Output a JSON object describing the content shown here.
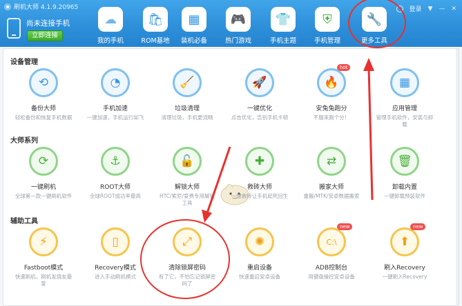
{
  "window": {
    "title": "刷机大师 4.1.9.20965",
    "login": "登录"
  },
  "device": {
    "status": "尚未连接手机",
    "connect_label": "立即连接"
  },
  "nav": [
    {
      "label": "我的手机",
      "icon": "cloud-icon",
      "color": "#6bb9ee"
    },
    {
      "label": "ROM基地",
      "icon": "shopping-bag-icon",
      "color": "#ffffff"
    },
    {
      "label": "装机必备",
      "icon": "grid-icon",
      "color": "#ffffff"
    },
    {
      "label": "热门游戏",
      "icon": "gamepad-icon",
      "color": "#f7a828"
    },
    {
      "label": "手机主题",
      "icon": "shirt-icon",
      "color": "#ffffff"
    },
    {
      "label": "手机管理",
      "icon": "shield-phone-icon",
      "color": "#4aae3c"
    },
    {
      "label": "更多工具",
      "icon": "wrench-icon",
      "color": "#3a98e0"
    }
  ],
  "sections": [
    {
      "title": "设备管理",
      "style": "blue",
      "tools": [
        {
          "name": "备份大师",
          "desc": "轻松备份和恢复手机数据",
          "icon": "restore-icon"
        },
        {
          "name": "手机加速",
          "desc": "一键加速，手机运行如飞",
          "icon": "speedometer-icon"
        },
        {
          "name": "垃圾清理",
          "desc": "清理垃圾，手机更流畅",
          "icon": "broom-icon"
        },
        {
          "name": "一键优化",
          "desc": "点击优化，告别手机卡顿",
          "icon": "rocket-icon"
        },
        {
          "name": "安兔兔跑分",
          "desc": "不服来跑个分！",
          "icon": "antutu-icon",
          "badge": "hot"
        },
        {
          "name": "应用管理",
          "desc": "管理手机软件，安装与卸载",
          "icon": "apps-icon"
        }
      ]
    },
    {
      "title": "大师系列",
      "style": "green",
      "tools": [
        {
          "name": "一键刷机",
          "desc": "全球第一款一键刷机软件",
          "icon": "refresh-icon"
        },
        {
          "name": "ROOT大师",
          "desc": "全球ROOT成功率最高",
          "icon": "anchor-icon"
        },
        {
          "name": "解锁大师",
          "desc": "HTC/索尼/爱费专用解锁工具",
          "icon": "unlock-icon"
        },
        {
          "name": "救砖大师",
          "desc": "一键救砖让手机起死回生",
          "icon": "phone-plus-icon"
        },
        {
          "name": "搬家大师",
          "desc": "重搬/MTK/安卓数据搬家",
          "icon": "transfer-icon"
        },
        {
          "name": "卸载内置",
          "desc": "一键卸载预装软件",
          "icon": "trash-icon"
        }
      ]
    },
    {
      "title": "辅助工具",
      "style": "orange",
      "tools": [
        {
          "name": "Fastboot模式",
          "desc": "快速刷机，刷机发烧友最爱",
          "icon": "lightning-icon"
        },
        {
          "name": "Recovery模式",
          "desc": "进入手动刷机模式",
          "icon": "phone-recovery-icon"
        },
        {
          "name": "清除锁屏密码",
          "desc": "有了它，不怕忘记锁屏密码了",
          "icon": "nodes-icon"
        },
        {
          "name": "重启设备",
          "desc": "快速重启安卓设备",
          "icon": "spinner-icon"
        },
        {
          "name": "ADB控制台",
          "desc": "用键盘操控安卓设备",
          "icon": "console-icon",
          "badge": "new"
        },
        {
          "name": "刷入Recovery",
          "desc": "一键刷入Recovery",
          "icon": "flash-recovery-icon",
          "badge": "new"
        }
      ]
    }
  ]
}
